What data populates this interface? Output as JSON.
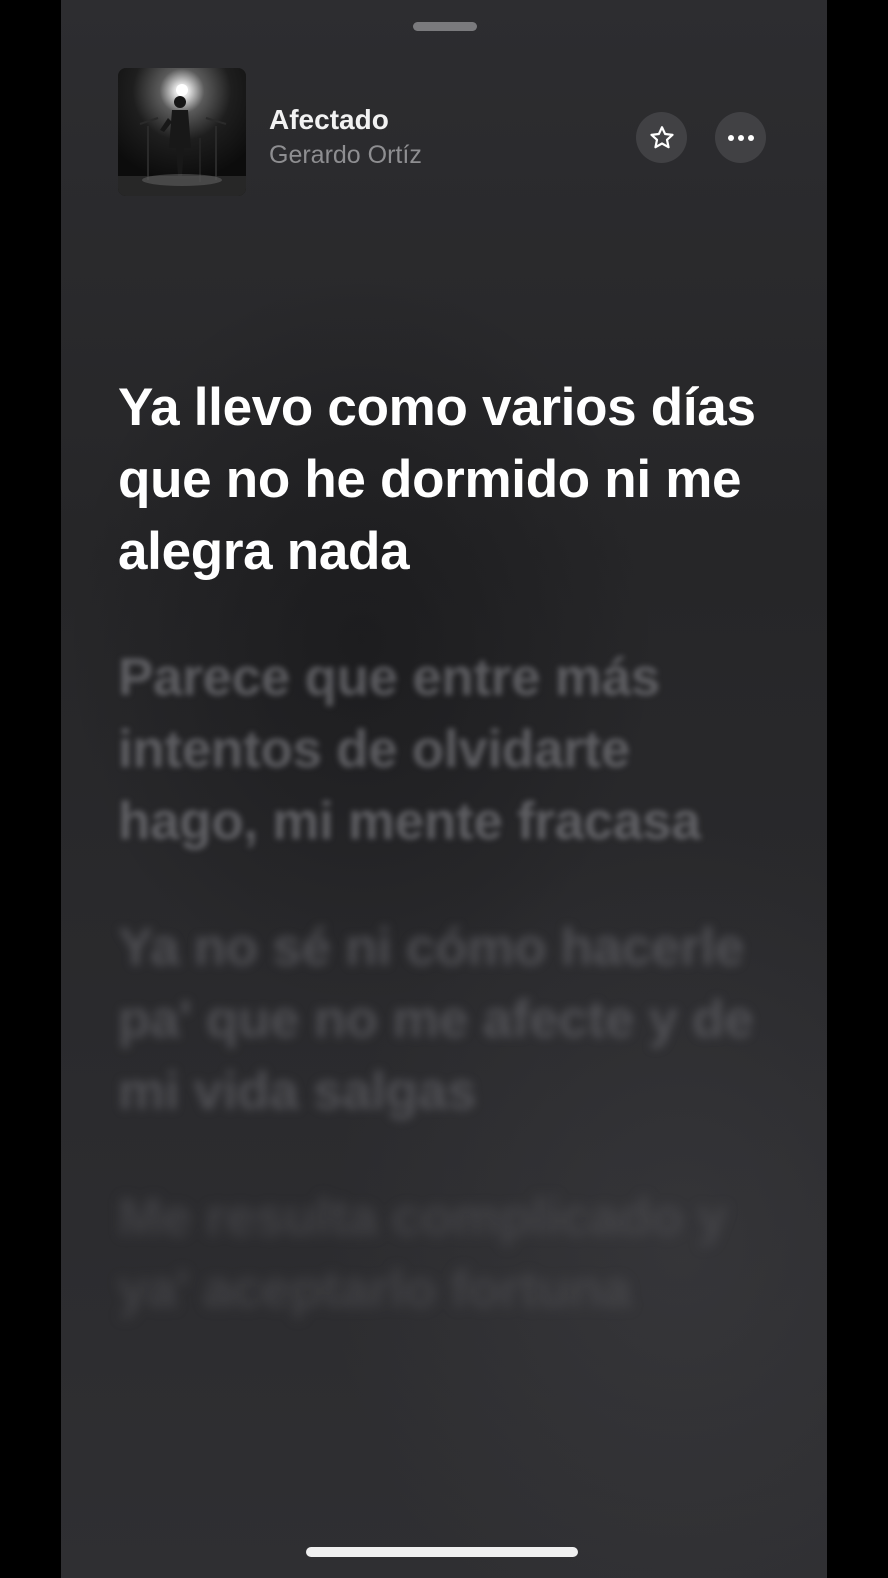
{
  "now_playing": {
    "title": "Afectado",
    "artist": "Gerardo Ortíz",
    "artwork_icon": "concert-photo-artwork",
    "favorite_icon": "star-icon",
    "more_icon": "ellipsis-icon"
  },
  "lyrics": {
    "active_line": "Ya llevo como varios días que no he dormido ni me alegra nada",
    "upcoming_lines": [
      "Parece que entre más intentos de olvidarte hago, mi mente fracasa",
      "Ya no sé ni cómo hacerle pa' que no me afecte y de mi vida salgas",
      "Me resulta complicado y ya' aceptarlo fortuna"
    ]
  },
  "colors": {
    "background": "#2a2a2d",
    "active_text": "#ffffff",
    "secondary_text": "#8e8e91",
    "button_bg": "#414144"
  }
}
